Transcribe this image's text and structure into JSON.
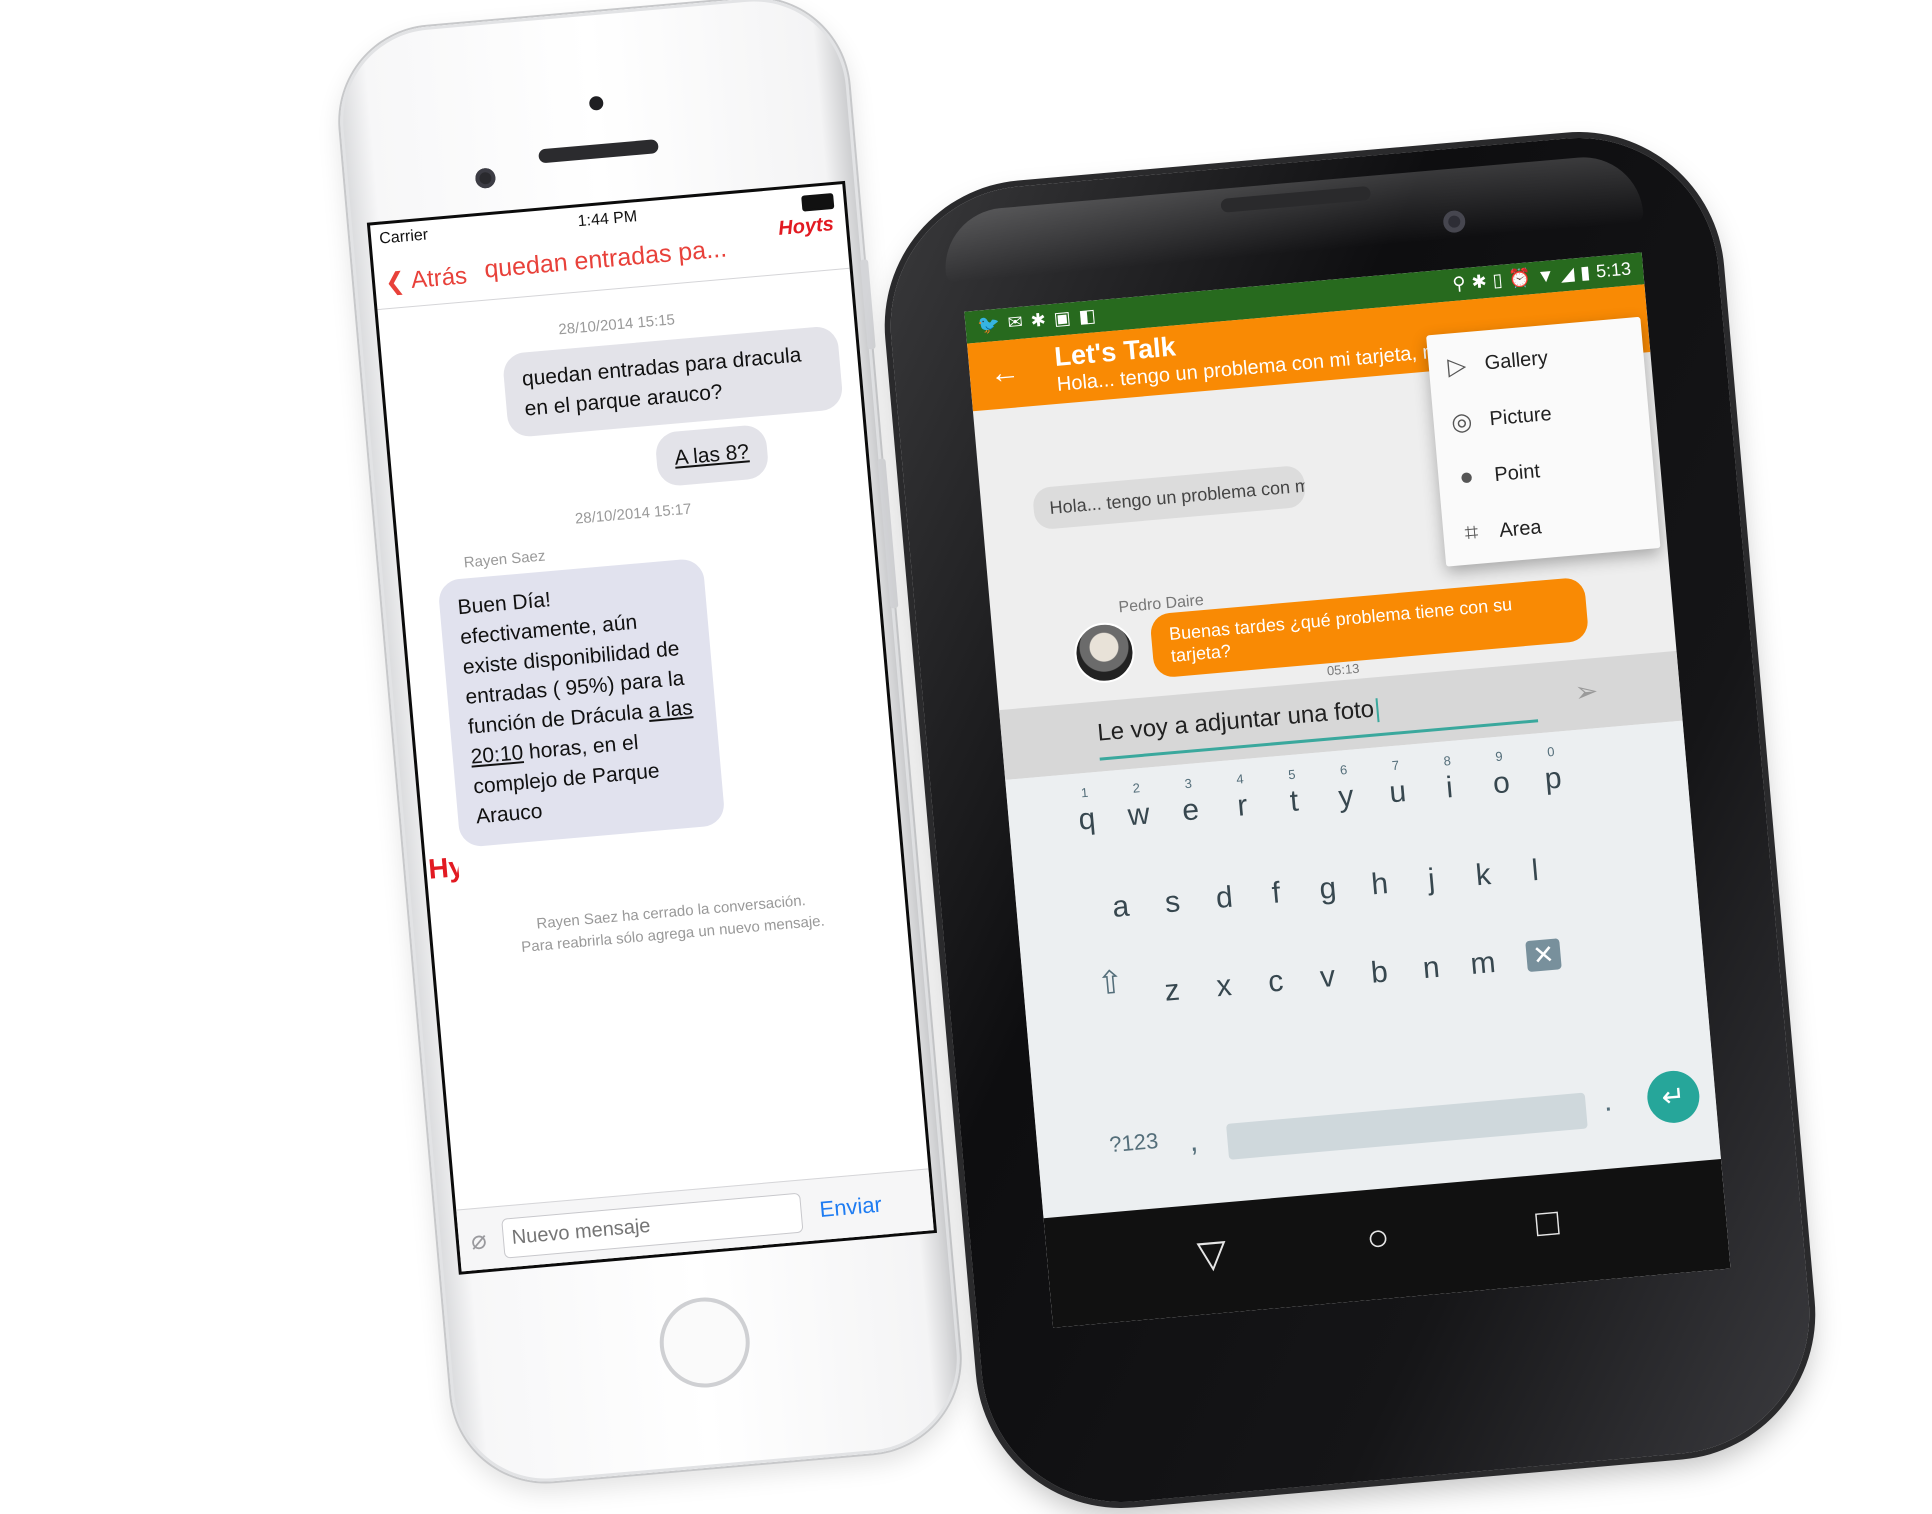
{
  "iphone": {
    "status": {
      "carrier": "Carrier",
      "time": "1:44 PM"
    },
    "nav": {
      "back_label": "Atrás",
      "title": "quedan entradas pa...",
      "brand": "Hoyts"
    },
    "messages": [
      {
        "date": "28/10/2014 15:15",
        "text": "quedan entradas para dracula en el parque arauco?"
      },
      {
        "text": "A las 8?"
      },
      {
        "date": "28/10/2014 15:17"
      }
    ],
    "incoming": {
      "sender": "Rayen Saez",
      "text_part1": "Buen Día! efectivamente, aún existe disponibilidad de entradas ( 95%) para la función de Drácula ",
      "text_link": "a las 20:10",
      "text_part2": " horas, en el complejo de Parque Arauco"
    },
    "closed_notice_line1": "Rayen Saez ha cerrado la conversación.",
    "closed_notice_line2": "Para reabrirla sólo agrega un nuevo mensaje.",
    "input": {
      "placeholder": "Nuevo mensaje",
      "send_label": "Enviar"
    }
  },
  "android": {
    "status": {
      "time": "5:13"
    },
    "toolbar": {
      "title": "Let's Talk",
      "subtitle": "Hola... tengo un problema con mi tarjeta, me pueden ayudar??"
    },
    "messages": [
      {
        "text": "Hola... tengo un problema con mi tarjeta, me pueden ayudar??"
      }
    ],
    "reply": {
      "sender": "Pedro Daire",
      "text": "Buenas tardes ¿qué problema tiene con su tarjeta?",
      "time": "05:13"
    },
    "input": {
      "value": "Le voy a adjuntar una foto"
    },
    "attach_menu": [
      {
        "label": "Gallery",
        "icon": "gallery-icon"
      },
      {
        "label": "Picture",
        "icon": "camera-icon"
      },
      {
        "label": "Point",
        "icon": "map-pin-icon"
      },
      {
        "label": "Area",
        "icon": "crop-area-icon"
      }
    ],
    "keyboard": {
      "row1": [
        "q",
        "w",
        "e",
        "r",
        "t",
        "y",
        "u",
        "i",
        "o",
        "p"
      ],
      "row1_hints": [
        "1",
        "2",
        "3",
        "4",
        "5",
        "6",
        "7",
        "8",
        "9",
        "0"
      ],
      "row2": [
        "a",
        "s",
        "d",
        "f",
        "g",
        "h",
        "j",
        "k",
        "l"
      ],
      "row3": [
        "z",
        "x",
        "c",
        "v",
        "b",
        "n",
        "m"
      ],
      "symbols_label": "?123",
      "comma": ",",
      "period": "."
    }
  },
  "colors": {
    "ios_accent": "#e8413a",
    "ios_link": "#1e7cf2",
    "android_primary": "#f98a04",
    "android_statusbar": "#276a1e",
    "android_accent": "#26a69a"
  }
}
